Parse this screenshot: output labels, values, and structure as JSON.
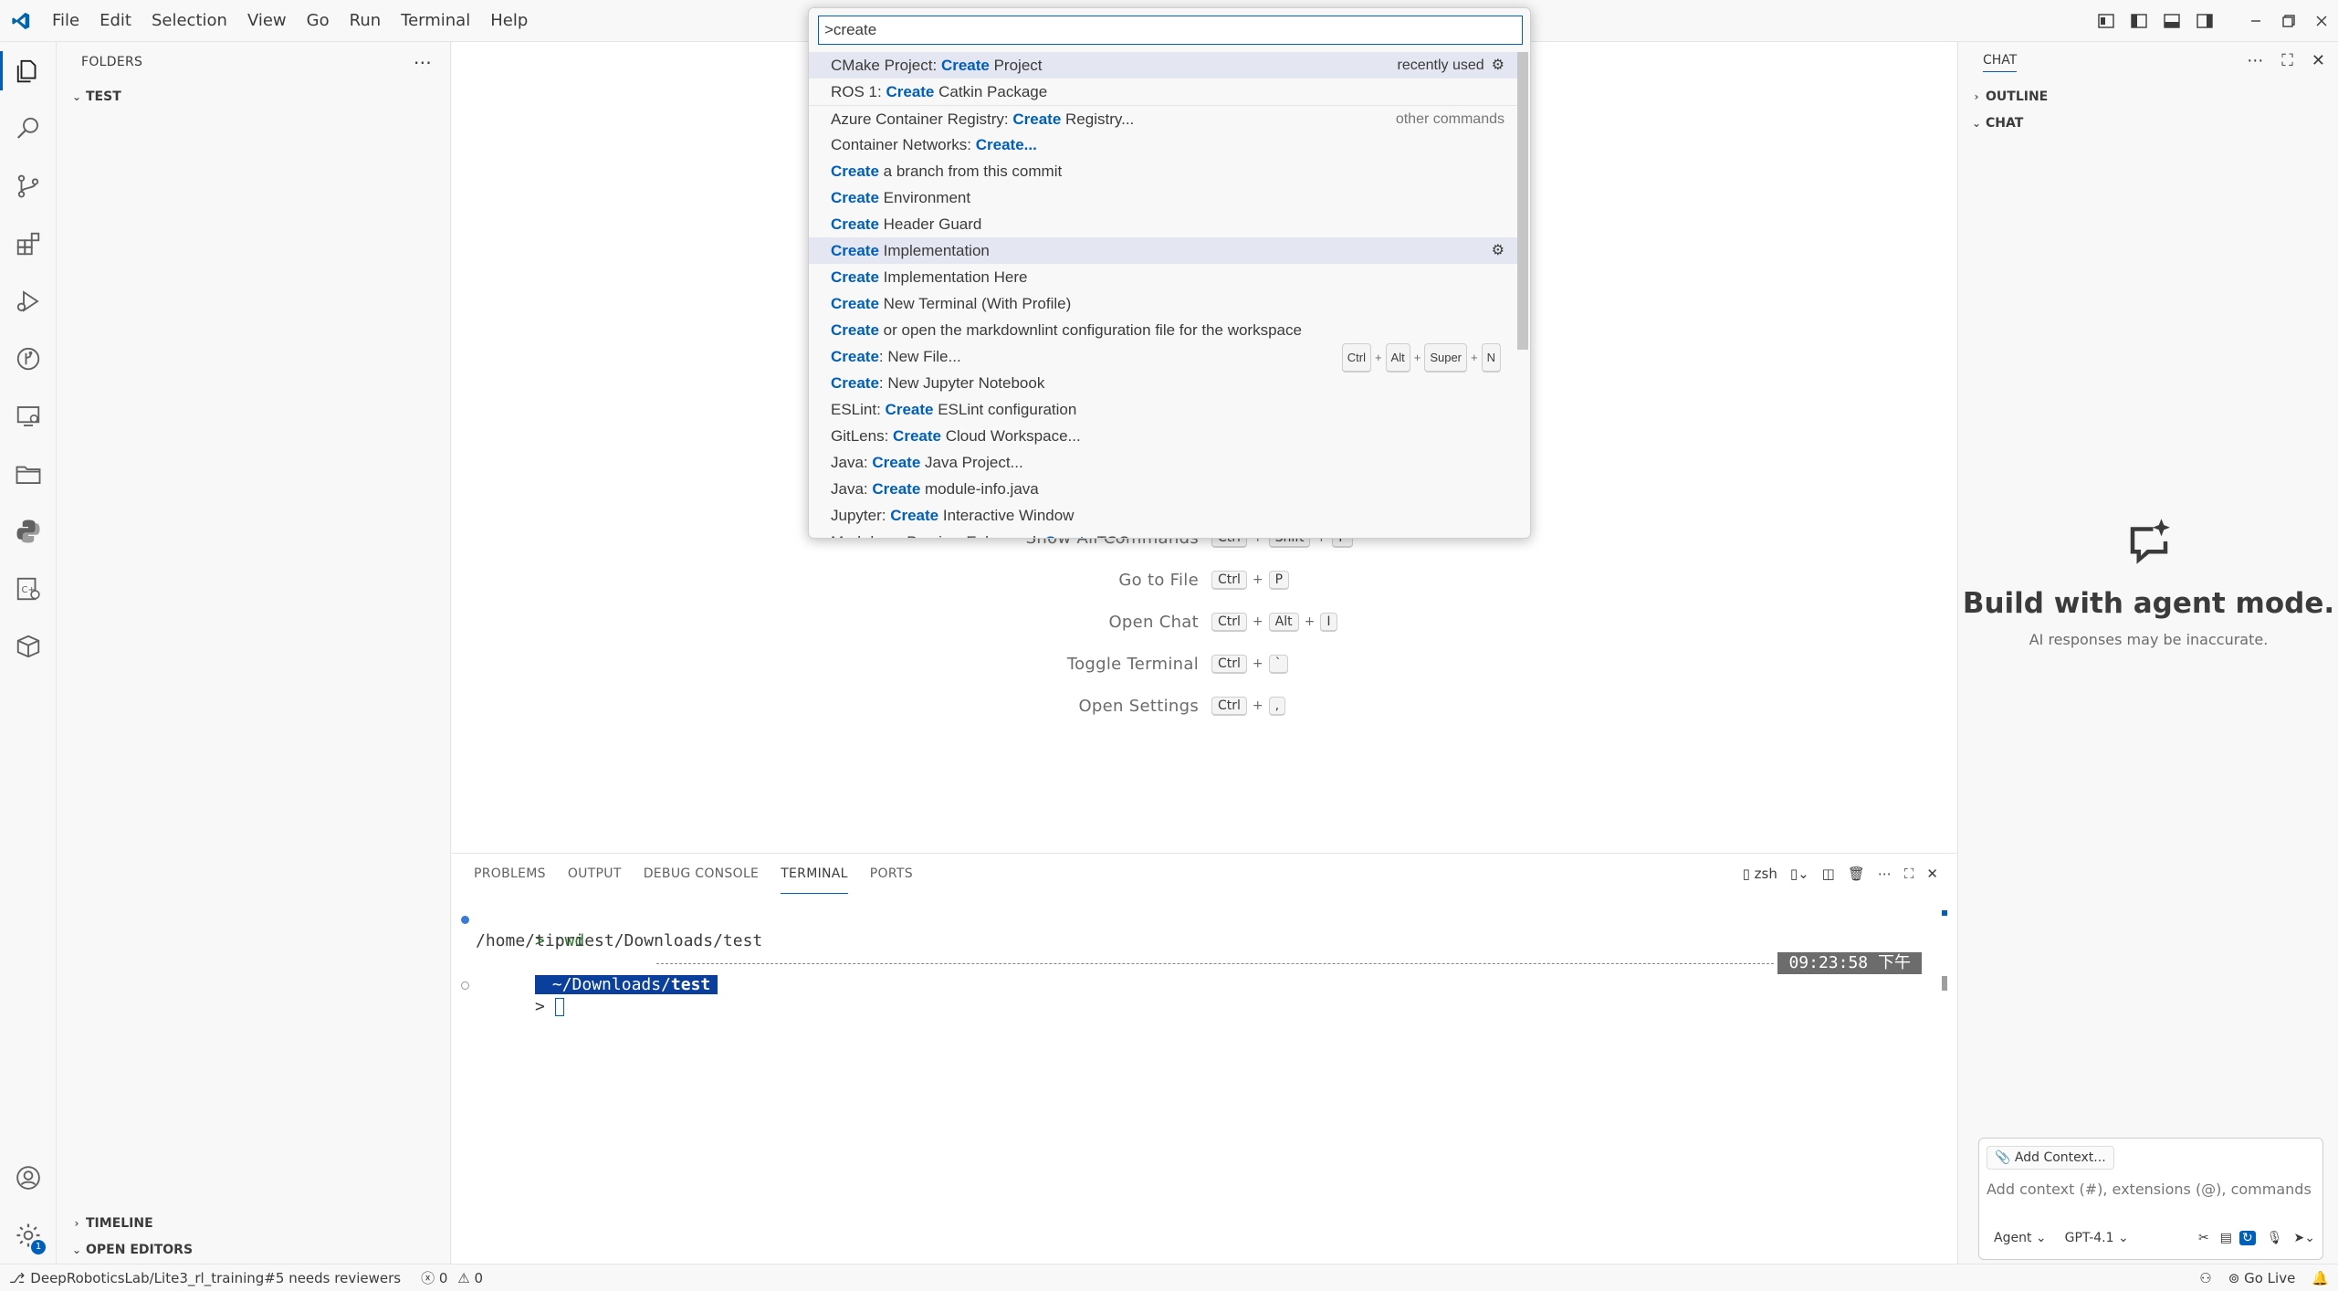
{
  "menu": [
    "File",
    "Edit",
    "Selection",
    "View",
    "Go",
    "Run",
    "Terminal",
    "Help"
  ],
  "palette": {
    "query": ">create",
    "items": [
      {
        "prefix": "CMake Project: ",
        "hl": "Create",
        "suffix": " Project",
        "right": "recently used",
        "gear": true
      },
      {
        "prefix": "ROS 1: ",
        "hl": "Create",
        "suffix": " Catkin Package"
      },
      {
        "prefix": "Azure Container Registry: ",
        "hl": "Create",
        "suffix": " Registry...",
        "right": "other commands",
        "muted": true
      },
      {
        "prefix": "Container Networks: ",
        "hl": "Create...",
        "suffix": ""
      },
      {
        "prefix": "",
        "hl": "Create",
        "suffix": " a branch from this commit"
      },
      {
        "prefix": "",
        "hl": "Create",
        "suffix": " Environment"
      },
      {
        "prefix": "",
        "hl": "Create",
        "suffix": " Header Guard"
      },
      {
        "prefix": "",
        "hl": "Create",
        "suffix": " Implementation",
        "gear": true
      },
      {
        "prefix": "",
        "hl": "Create",
        "suffix": " Implementation Here"
      },
      {
        "prefix": "",
        "hl": "Create",
        "suffix": " New Terminal (With Profile)"
      },
      {
        "prefix": "",
        "hl": "Create",
        "suffix": " or open the markdownlint configuration file for the workspace"
      },
      {
        "prefix": "",
        "hl": "Create",
        "suffix": ": New File...",
        "keys": [
          "Ctrl",
          "Alt",
          "Super",
          "N"
        ]
      },
      {
        "prefix": "",
        "hl": "Create",
        "suffix": ": New Jupyter Notebook"
      },
      {
        "prefix": "ESLint: ",
        "hl": "Create",
        "suffix": " ESLint configuration"
      },
      {
        "prefix": "GitLens: ",
        "hl": "Create",
        "suffix": " Cloud Workspace..."
      },
      {
        "prefix": "Java: ",
        "hl": "Create",
        "suffix": " Java Project..."
      },
      {
        "prefix": "Java: ",
        "hl": "Create",
        "suffix": " module-info.java"
      },
      {
        "prefix": "Jupyter: ",
        "hl": "Create",
        "suffix": " Interactive Window"
      },
      {
        "prefix": "Markdown Preview Enhanced: ",
        "hl": "Create",
        "suffix": " TOC"
      }
    ]
  },
  "sidebar": {
    "header": "FOLDERS",
    "folder": "TEST",
    "timeline": "TIMELINE",
    "open_editors": "OPEN EDITORS"
  },
  "editor": {
    "shortcuts": [
      {
        "label": "Show All Commands",
        "keys": [
          "Ctrl",
          "Shift",
          "P"
        ]
      },
      {
        "label": "Go to File",
        "keys": [
          "Ctrl",
          "P"
        ]
      },
      {
        "label": "Open Chat",
        "keys": [
          "Ctrl",
          "Alt",
          "I"
        ]
      },
      {
        "label": "Toggle Terminal",
        "keys": [
          "Ctrl",
          "`"
        ]
      },
      {
        "label": "Open Settings",
        "keys": [
          "Ctrl",
          ","
        ]
      }
    ]
  },
  "panel": {
    "tabs": [
      "PROBLEMS",
      "OUTPUT",
      "DEBUG CONSOLE",
      "TERMINAL",
      "PORTS"
    ],
    "shell": "zsh",
    "terminal": {
      "cmd_prompt": "> ",
      "cmd": "pwd",
      "output": "/home/tipriest/Downloads/test",
      "path_dir": " ~/Downloads/",
      "path_last": "test",
      "time": "09:23:58 下午",
      "prompt2": "> "
    }
  },
  "chat": {
    "header": "CHAT",
    "outline": "OUTLINE",
    "chat_section": "CHAT",
    "title": "Build with agent mode.",
    "subtitle": "AI responses may be inaccurate.",
    "add_context": "Add Context...",
    "placeholder": "Add context (#), extensions (@), commands (/)",
    "mode": "Agent",
    "model": "GPT-4.1"
  },
  "statusbar": {
    "branch": "DeepRoboticsLab/Lite3_rl_training#5 needs reviewers",
    "errors": "0",
    "warnings": "0",
    "go_live": "Go Live"
  },
  "colors": {
    "accent": "#005fb8",
    "highlight_bg": "#0b3f9c"
  }
}
